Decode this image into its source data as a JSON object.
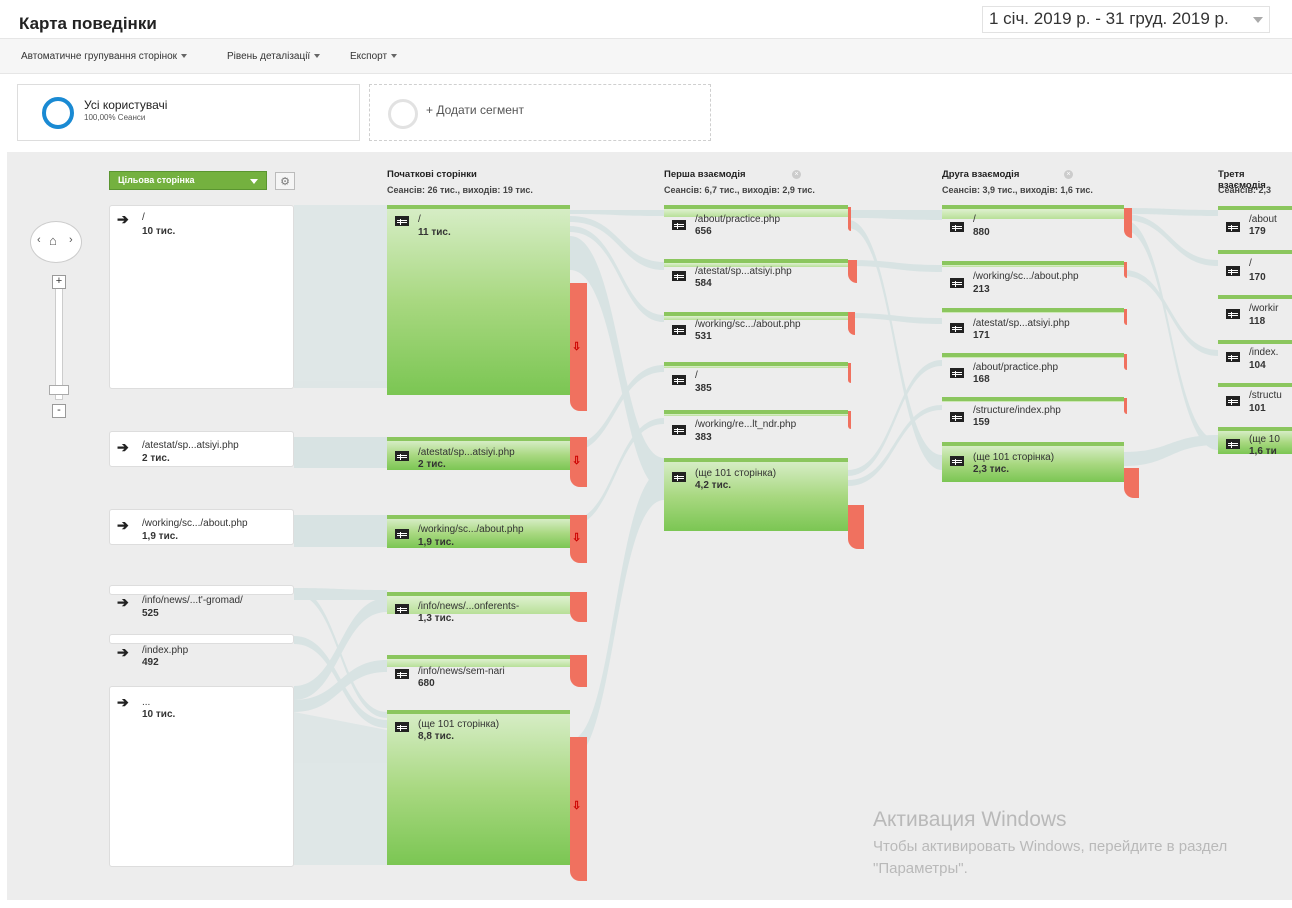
{
  "page": {
    "title": "Карта поведінки",
    "date_range": "1 січ. 2019 р. - 31 груд. 2019 р."
  },
  "toolbar": {
    "grouping": "Автоматичне групування сторінок",
    "detail": "Рівень деталізації",
    "export": "Експорт"
  },
  "segments": {
    "all_users": {
      "name": "Усі користувачі",
      "sub": "100,00% Сеанси"
    },
    "add": "+ Додати сегмент"
  },
  "dimension": {
    "label": "Цільова сторінка"
  },
  "columns": [
    {
      "title": "Початкові сторінки",
      "stats": "Сеансів: 26 тис., виходів: 19 тис."
    },
    {
      "title": "Перша взаємодія",
      "stats": "Сеансів: 6,7 тис., виходів: 2,9 тис."
    },
    {
      "title": "Друга взаємодія",
      "stats": "Сеансів: 3,9 тис., виходів: 1,6 тис."
    },
    {
      "title": "Третя взаємодія",
      "stats": "Сеансів: 2,3"
    }
  ],
  "landing": [
    {
      "label": "/",
      "value": "10 тис."
    },
    {
      "label": "/atestat/sp...atsiyi.php",
      "value": "2 тис."
    },
    {
      "label": "/working/sc.../about.php",
      "value": "1,9 тис."
    },
    {
      "label": "/info/news/...t'-gromad/",
      "value": "525"
    },
    {
      "label": "/index.php",
      "value": "492"
    },
    {
      "label": "...",
      "value": "10 тис."
    }
  ],
  "start_pages": [
    {
      "label": "/",
      "value": "11 тис."
    },
    {
      "label": "/atestat/sp...atsiyi.php",
      "value": "2 тис."
    },
    {
      "label": "/working/sc.../about.php",
      "value": "1,9 тис."
    },
    {
      "label": "/info/news/...onferents-",
      "value": "1,3 тис."
    },
    {
      "label": "/info/news/sem-nari",
      "value": "680"
    },
    {
      "label": "(ще 101 сторінка)",
      "value": "8,8 тис."
    }
  ],
  "first": [
    {
      "label": "/about/practice.php",
      "value": "656"
    },
    {
      "label": "/atestat/sp...atsiyi.php",
      "value": "584"
    },
    {
      "label": "/working/sc.../about.php",
      "value": "531"
    },
    {
      "label": "/",
      "value": "385"
    },
    {
      "label": "/working/re...lt_ndr.php",
      "value": "383"
    },
    {
      "label": "(ще 101 сторінка)",
      "value": "4,2 тис."
    }
  ],
  "second": [
    {
      "label": "/",
      "value": "880"
    },
    {
      "label": "/working/sc.../about.php",
      "value": "213"
    },
    {
      "label": "/atestat/sp...atsiyi.php",
      "value": "171"
    },
    {
      "label": "/about/practice.php",
      "value": "168"
    },
    {
      "label": "/structure/index.php",
      "value": "159"
    },
    {
      "label": "(ще 101 сторінка)",
      "value": "2,3 тис."
    }
  ],
  "third": [
    {
      "label": "/about",
      "value": "179"
    },
    {
      "label": "/",
      "value": "170"
    },
    {
      "label": "/workir",
      "value": "118"
    },
    {
      "label": "/index.",
      "value": "104"
    },
    {
      "label": "/structu",
      "value": "101"
    },
    {
      "label": "(ще 10",
      "value": "1,6 ти"
    }
  ],
  "watermark": {
    "line1": "Активация Windows",
    "line2": "Чтобы активировать Windows, перейдите в раздел \"Параметры\"."
  },
  "colors": {
    "node_green": "#7bc653",
    "exit_red": "#f0715f",
    "accent_blue": "#1a8ad3"
  },
  "icons": {
    "zoom_home": "home-icon",
    "settings": "gear-icon",
    "page": "page-icon",
    "entry": "fork-arrow-icon",
    "drop": "down-arrow-icon"
  }
}
